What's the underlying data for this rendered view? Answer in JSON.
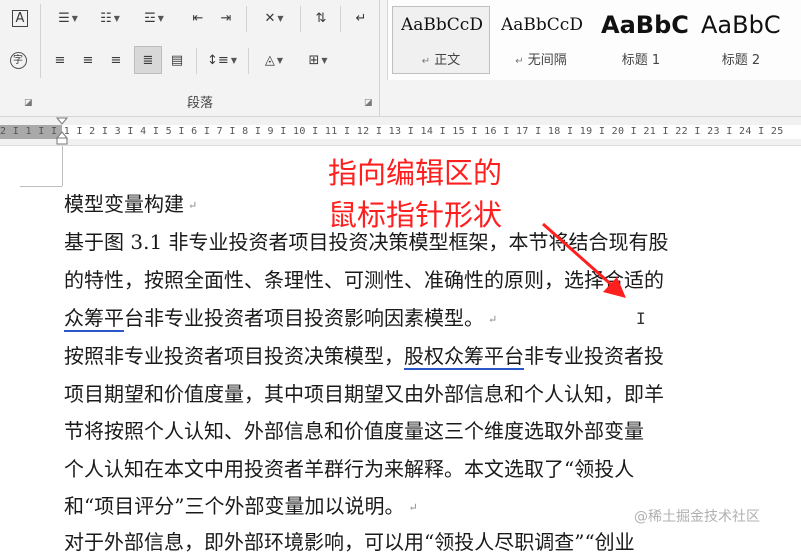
{
  "ribbon": {
    "paragraph_group_label": "段落",
    "icons": {
      "row1": [
        "char-border-icon",
        "bullets-icon",
        "numbering-icon",
        "multilevel-list-icon",
        "decrease-indent-icon",
        "increase-indent-icon",
        "chinese-layout-icon",
        "sort-icon",
        "show-marks-icon"
      ],
      "row2": [
        "enclose-char-icon",
        "align-left-icon",
        "center-icon",
        "align-right-icon",
        "justify-icon",
        "distributed-icon",
        "line-spacing-icon",
        "shading-icon",
        "borders-icon"
      ]
    },
    "styles": [
      {
        "sample": "AaBbCcD",
        "name": "正文",
        "marker": "↵"
      },
      {
        "sample": "AaBbCcD",
        "name": "无间隔",
        "marker": "↵"
      },
      {
        "sample": "AaBbC",
        "name": "标题 1",
        "marker": ""
      },
      {
        "sample": "AaBbC",
        "name": "标题 2",
        "marker": ""
      }
    ]
  },
  "ruler": {
    "text": "2 I 1 I    I 1 I 2 I 3 I 4 I 5 I 6 I 7 I 8 I 9 I 10 I 11 I 12 I 13 I 14 I 15 I 16 I 17 I 18 I 19 I 20 I 21 I 22 I 23 I 24 I 25"
  },
  "document": {
    "lines": [
      {
        "text": "模型变量构建",
        "mark": "↵"
      },
      {
        "text": "基于图 3.1 非专业投资者项目投资决策模型框架，本节将结合现有股",
        "mark": ""
      },
      {
        "text": "的特性，按照全面性、条理性、可测性、准确性的原则，选择合适的",
        "mark": ""
      },
      {
        "pre": "众筹平",
        "text": "台非专业投资者项目投资影响因素模型。",
        "mark": "↵"
      },
      {
        "text": "按照非专业投资者项目投资决策模型，",
        "u": "股权众筹平台",
        "post": "非专业投资者投",
        "mark": ""
      },
      {
        "text": "项目期望和价值度量，其中项目期望又由外部信息和个人认知，即羊",
        "mark": ""
      },
      {
        "text": "节将按照个人认知、外部信息和价值度量这三个维度选取外部变量",
        "mark": ""
      },
      {
        "text": "个人认知在本文中用投资者羊群行为来解释。本文选取了“领投人",
        "mark": ""
      },
      {
        "text": "和“项目评分”三个外部变量加以说明。",
        "mark": "↵"
      },
      {
        "text": "对于外部信息，即外部环境影响，可以用“领投人尽职调查”“创业",
        "mark": ""
      }
    ]
  },
  "annotation": {
    "line1": "指向编辑区的",
    "line2": "鼠标指针形状",
    "color": "#ff1f1f"
  },
  "cursor": "I",
  "watermark": "@稀土掘金技术社区"
}
